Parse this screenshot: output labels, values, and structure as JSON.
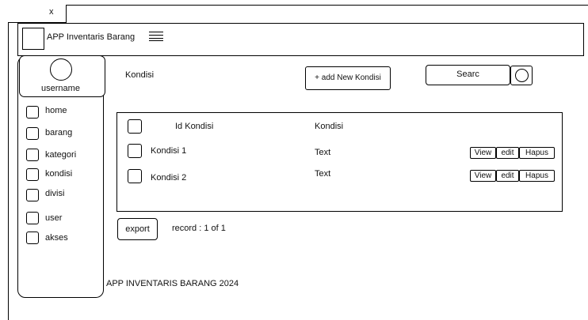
{
  "window": {
    "close_label": "x"
  },
  "header": {
    "app_title": "APP Inventaris Barang",
    "menu_icon": "hamburger-icon"
  },
  "user": {
    "username": "username"
  },
  "sidebar": {
    "items": [
      {
        "label": "home"
      },
      {
        "label": "barang"
      },
      {
        "label": "kategori"
      },
      {
        "label": "kondisi"
      },
      {
        "label": "divisi"
      },
      {
        "label": "user"
      },
      {
        "label": "akses"
      }
    ]
  },
  "main": {
    "title": "Kondisi",
    "add_button": "+ add New Kondisi",
    "search_text": "Searc",
    "table": {
      "columns": [
        "Id Kondisi",
        "Kondisi"
      ],
      "rows": [
        {
          "id": "Kondisi 1",
          "kondisi": "Text",
          "actions": [
            "View",
            "edit",
            "Hapus"
          ]
        },
        {
          "id": "Kondisi 2",
          "kondisi": "Text",
          "actions": [
            "View",
            "edit",
            "Hapus"
          ]
        }
      ]
    },
    "export_button": "export",
    "record_text": "record : 1 of 1"
  },
  "footer": {
    "text": "APP INVENTARIS BARANG 2024"
  }
}
